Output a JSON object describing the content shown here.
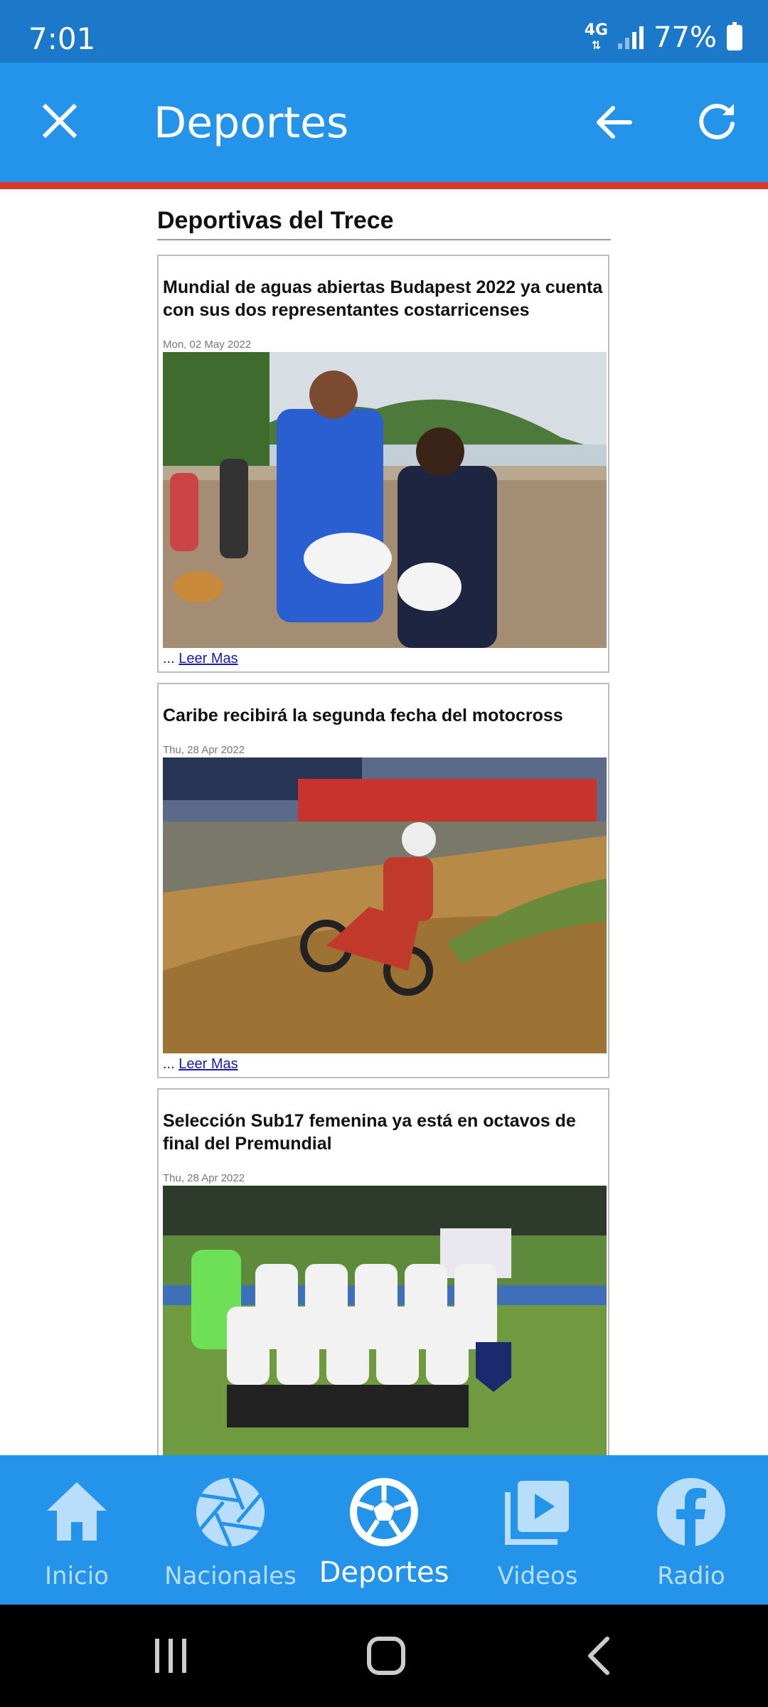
{
  "status_bar": {
    "time": "7:01",
    "network": "4G",
    "battery": "77%"
  },
  "app_bar": {
    "title": "Deportes"
  },
  "section": {
    "title": "Deportivas del Trece"
  },
  "articles": [
    {
      "title": "Mundial de aguas abiertas Budapest 2022 ya cuenta con sus dos representantes costarricenses",
      "date": "Mon, 02 May 2022",
      "ellipsis": "...",
      "link": "Leer Mas"
    },
    {
      "title": "Caribe recibirá la segunda fecha del motocross",
      "date": "Thu, 28 Apr 2022",
      "ellipsis": "...",
      "link": "Leer Mas"
    },
    {
      "title": "Selección Sub17 femenina ya está en octavos de final del Premundial",
      "date": "Thu, 28 Apr 2022"
    }
  ],
  "bottom_nav": [
    {
      "label": "Inicio",
      "icon": "home-icon"
    },
    {
      "label": "Nacionales",
      "icon": "aperture-icon"
    },
    {
      "label": "Deportes",
      "icon": "soccer-ball-icon",
      "active": true
    },
    {
      "label": "Videos",
      "icon": "video-library-icon"
    },
    {
      "label": "Radio",
      "icon": "facebook-icon"
    }
  ],
  "colors": {
    "primary": "#2494ea",
    "status_bar": "#1c78c8",
    "accent_line": "#d9382d",
    "nav_inactive": "#b9defc"
  }
}
